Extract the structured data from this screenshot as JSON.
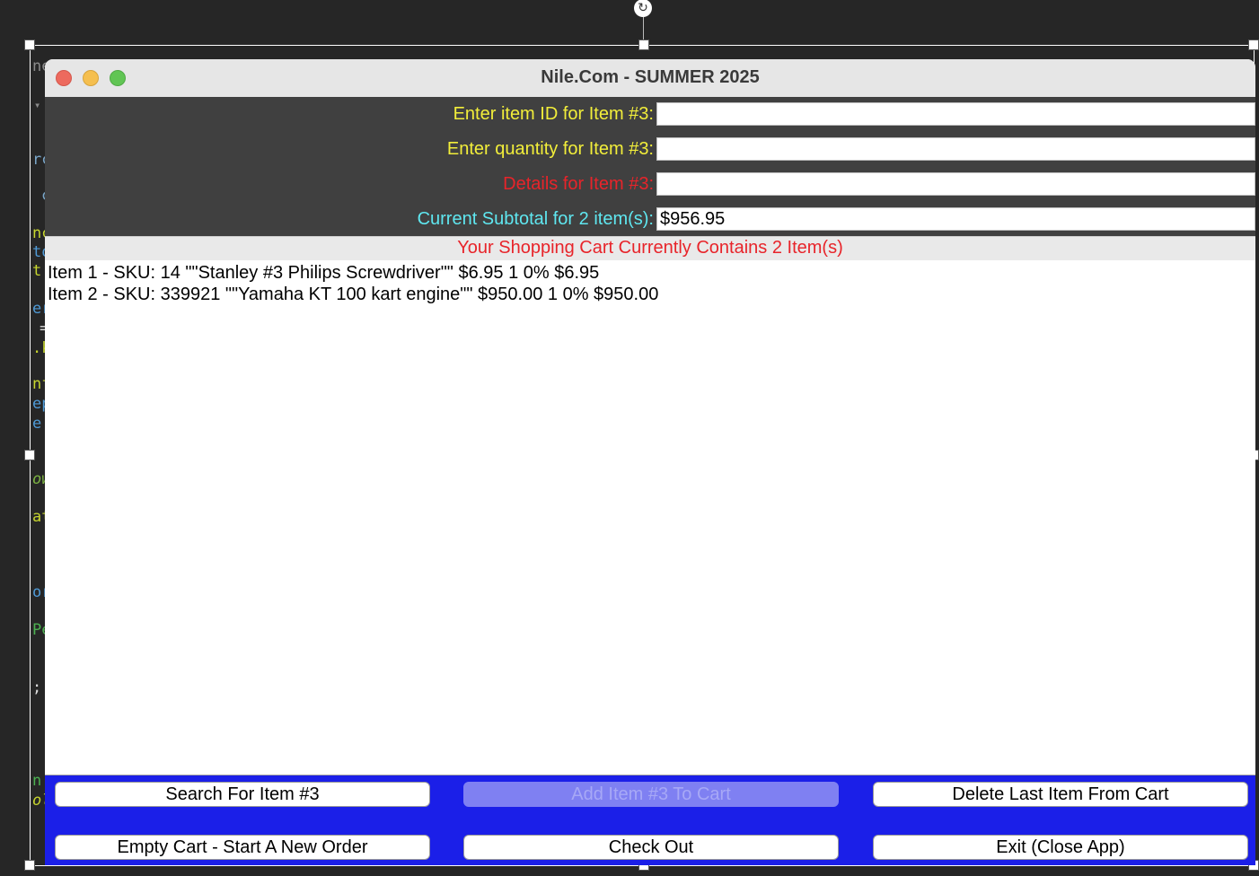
{
  "window": {
    "title": "Nile.Com - SUMMER 2025"
  },
  "form": {
    "item_id_label": "Enter item ID for Item #3:",
    "item_id_value": "",
    "quantity_label": "Enter quantity for Item #3:",
    "quantity_value": "",
    "details_label": "Details for Item #3:",
    "details_value": "",
    "subtotal_label": "Current Subtotal for 2 item(s):",
    "subtotal_value": "$956.95"
  },
  "cart": {
    "header": "Your Shopping Cart Currently Contains 2 Item(s)",
    "items": [
      "Item 1 - SKU: 14 \"\"Stanley #3 Philips Screwdriver\"\" $6.95 1 0% $6.95",
      "Item 2 - SKU: 339921 \"\"Yamaha KT 100 kart engine\"\" $950.00 1 0% $950.00"
    ]
  },
  "buttons": {
    "search": "Search For Item #3",
    "add": "Add Item #3 To Cart",
    "delete": "Delete Last Item From Cart",
    "empty": "Empty Cart - Start A New Order",
    "checkout": "Check Out",
    "exit": "Exit (Close App)"
  },
  "background_code": {
    "fragments": [
      "ne",
      "▾",
      "rc",
      "c",
      "nc",
      "to",
      "t:",
      "er",
      "=",
      ".k",
      "nf",
      "ep",
      "e.",
      "ow",
      "at",
      "or",
      "Pe",
      ";",
      "n",
      "ol"
    ]
  },
  "colors": {
    "label_yellow": "#f2ee3a",
    "label_red": "#e8242a",
    "label_cyan": "#5fe7f0",
    "input_panel_bg": "#404040",
    "button_panel_bg": "#1b1fe8",
    "disabled_button_bg": "#7f80f2"
  }
}
